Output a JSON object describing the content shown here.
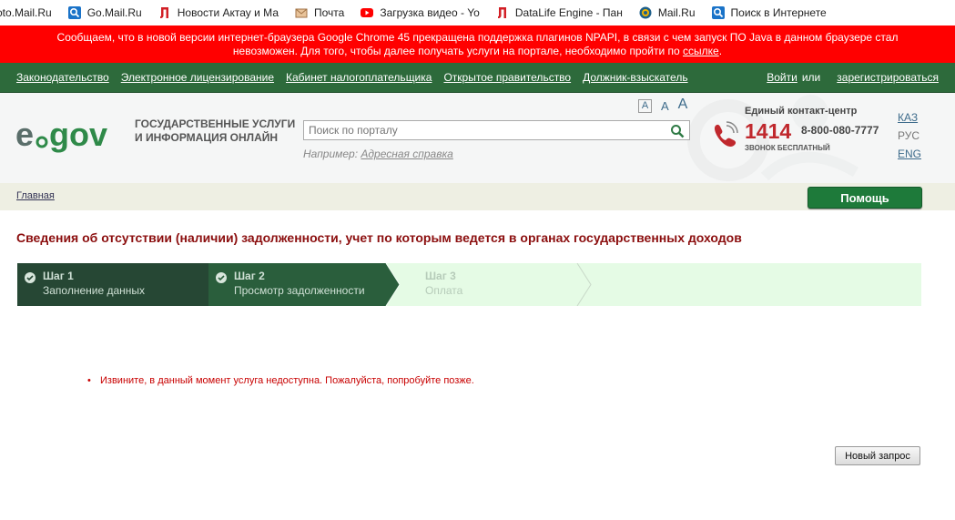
{
  "bookmarks": [
    {
      "label": "oto.Mail.Ru",
      "icon": "none"
    },
    {
      "label": "Go.Mail.Ru",
      "icon": "search-icon"
    },
    {
      "label": "Новости Актау и Ма",
      "icon": "letter-l-icon"
    },
    {
      "label": "Почта",
      "icon": "envelope-icon"
    },
    {
      "label": "Загрузка видео - Yo",
      "icon": "youtube-icon"
    },
    {
      "label": "DataLife Engine - Пан",
      "icon": "letter-l-icon"
    },
    {
      "label": "Mail.Ru",
      "icon": "globe-icon"
    },
    {
      "label": "Поиск в Интернете",
      "icon": "search-icon"
    }
  ],
  "notice": {
    "line1": "Сообщаем, что в новой версии интернет-браузера Google Chrome 45 прекращена поддержка плагинов NPAPI, в связи с чем запуск ПО Java в данном браузере стал",
    "line2_pre": "невозможен. Для того, чтобы далее получать услуги на портале, необходимо пройти по ",
    "link": "ссылке",
    "line2_post": "."
  },
  "topnav": {
    "links": [
      "Законодательство ",
      "Электронное лицензирование",
      "Кабинет налогоплательщика",
      "Открытое правительство",
      "Должник-взыскатель"
    ],
    "login": "Войти",
    "or": "или",
    "register": "зарегистрироваться"
  },
  "header": {
    "logo_text": "e gov",
    "tagline_1": "ГОСУДАРСТВЕННЫЕ УСЛУГИ",
    "tagline_2": "И ИНФОРМАЦИЯ ОНЛАЙН",
    "font_sizes": [
      "A",
      "A",
      "A"
    ],
    "search_placeholder": "Поиск по порталу",
    "example_label": "Например: ",
    "example_link": "Адресная справка",
    "contact_label": "Единый контакт-центр",
    "contact_number": "1414",
    "contact_phone": "8-800-080-7777",
    "contact_free": "ЗВОНОК БЕСПЛАТНЫЙ",
    "langs": {
      "kaz": "КАЗ",
      "rus": "РУС",
      "eng": "ENG"
    }
  },
  "breadcrumb": {
    "home": "Главная"
  },
  "help_button": "Помощь",
  "page_title": "Сведения об отсутствии (наличии) задолженности, учет по которым ведется в органах государственных доходов",
  "steps": [
    {
      "title": "Шаг 1",
      "subtitle": "Заполнение данных",
      "state": "done"
    },
    {
      "title": "Шаг 2",
      "subtitle": "Просмотр задолженности",
      "state": "current"
    },
    {
      "title": "Шаг 3",
      "subtitle": "Оплата",
      "state": "pending"
    }
  ],
  "error_message": "Извините, в данный момент услуга недоступна. Пожалуйста, попробуйте позже.",
  "new_request_button": "Новый запрос",
  "colors": {
    "notice": "#ff0000",
    "nav": "#2d6a3b",
    "title": "#8b0e0e",
    "error": "#c80000",
    "help": "#1e7a3a"
  }
}
